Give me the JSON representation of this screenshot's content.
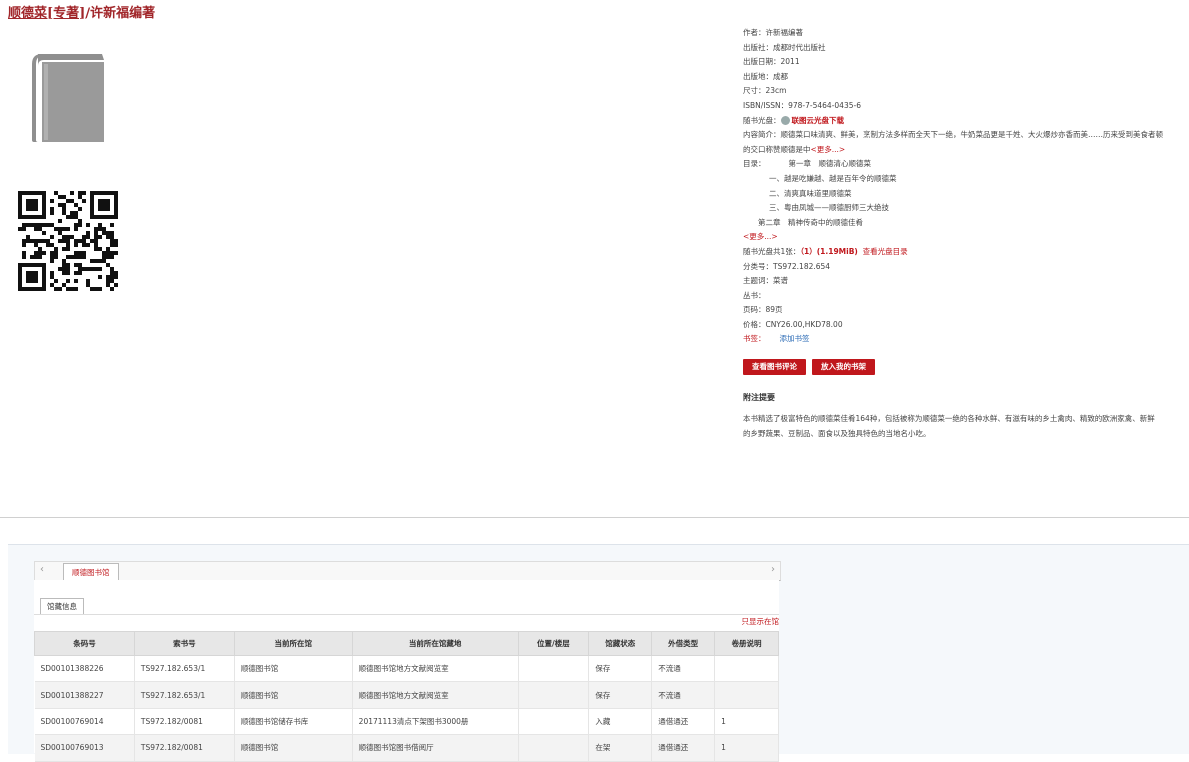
{
  "header": {
    "title_series": "顺德菜[专著]",
    "title_sep": "/",
    "title_author": "许新福编著"
  },
  "cover": {
    "icon": "book-icon"
  },
  "qr": {
    "icon": "qr-code-icon"
  },
  "meta": {
    "author_label": "作者：",
    "author": "许新福编著",
    "publisher_label": "出版社：",
    "publisher": "成都时代出版社",
    "date_label": "出版日期：",
    "date": "2011",
    "place_label": "出版地：",
    "place": "成都",
    "size_label": "尺寸：",
    "size": "23cm",
    "isbn_label": "ISBN/ISSN：",
    "isbn": "978-7-5464-0435-6",
    "disc_label": "随书光盘：",
    "disc_link": "联图云光盘下载",
    "intro_label": "内容简介：",
    "intro": "顺德菜口味清爽、鲜美，烹制方法多样而全天下一绝，牛奶菜品更是千姓、大火爆炒亦香而美……历来受到美食者顿的交口称赞顺德是中",
    "intro_more": "<更多...>",
    "toc_label": "目录：",
    "toc": [
      "第一章　顺德清心顺德菜",
      "一、越是吃嫌越、越是百年令的顺德菜",
      "二、清爽真味道里顺德菜",
      "三、粤由凤城——顺德厨师三大绝技",
      "第二章　精神传奇中的顺德佳肴"
    ],
    "toc_more": "<更多...>",
    "disc_count_label": "随书光盘共1张：",
    "disc_count": "（1）(1.19MiB)",
    "disc_toc_link": "查看光盘目录",
    "class_label": "分类号：",
    "class": "TS972.182.654",
    "subject_label": "主题词：",
    "subject": "菜谱",
    "series_label": "丛书：",
    "series": "",
    "pages_label": "页码：",
    "pages": "89页",
    "price_label": "价格：",
    "price": "CNY26.00,HKD78.00",
    "bookmark_label": "书签：",
    "bookmark_link": "添加书签"
  },
  "buttons": {
    "review": "查看图书评论",
    "shelf": "放入我的书架"
  },
  "extra": {
    "heading": "附注提要",
    "text": "本书精选了极富特色的顺德菜佳肴164种，包括被称为顺德菜一绝的各种水鲜、有滋有味的乡土禽肉、精致的欧洲家禽、新鲜的乡野蔬果、豆制品、面食以及独具特色的当地名小吃。"
  },
  "holdings": {
    "library_tab": "顺德图书馆",
    "sub_tab": "馆藏信息",
    "loc_link": "只显示在馆",
    "columns": [
      "条码号",
      "索书号",
      "当前所在馆",
      "当前所在馆藏地",
      "位置/楼层",
      "馆藏状态",
      "外借类型",
      "卷册说明"
    ],
    "rows": [
      [
        "SD00101388226",
        "TS927.182.653/1",
        "顺德图书馆",
        "顺德图书馆地方文献阅览室",
        "",
        "保存",
        "不流通",
        ""
      ],
      [
        "SD00101388227",
        "TS927.182.653/1",
        "顺德图书馆",
        "顺德图书馆地方文献阅览室",
        "",
        "保存",
        "不流通",
        ""
      ],
      [
        "SD00100769014",
        "TS972.182/0081",
        "顺德图书馆储存书库",
        "20171113清点下架图书3000册",
        "",
        "入藏",
        "通借通还",
        "1"
      ],
      [
        "SD00100769013",
        "TS972.182/0081",
        "顺德图书馆",
        "顺德图书馆图书借阅厅",
        "",
        "在架",
        "通借通还",
        "1"
      ]
    ]
  }
}
